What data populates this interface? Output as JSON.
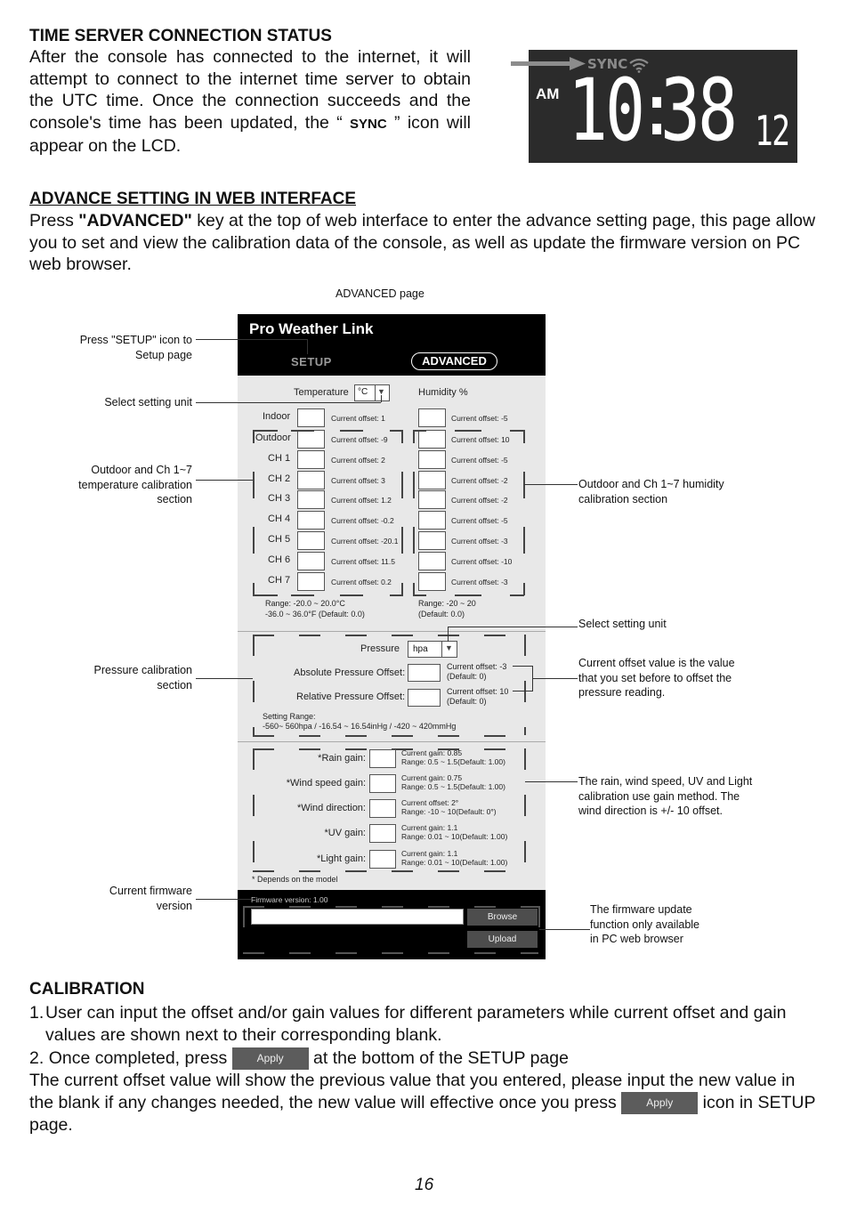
{
  "time_server": {
    "heading": "TIME SERVER CONNECTION STATUS",
    "para_before": "After the console has connected to the internet, it will attempt to connect to the internet time server to obtain the UTC time. Once the connection succeeds and the console's time has been updated, the “",
    "sync_word": "SYNC",
    "para_after": "” icon will appear on the LCD.",
    "lcd": {
      "sync_label": "SYNC",
      "ampm": "AM",
      "hours": "10",
      "minutes": "38",
      "seconds": "12",
      "icons": [
        "arrow-right-icon",
        "wifi-icon"
      ]
    }
  },
  "advance": {
    "heading": "ADVANCE SETTING IN WEB INTERFACE",
    "para_prefix": "Press ",
    "para_key": "\"ADVANCED\"",
    "para_suffix": " key at the top of web interface to enter the advance setting page, this page allow you to set and view the calibration data of the console, as well as update the firmware version on PC web browser.",
    "figure_caption": "ADVANCED page"
  },
  "web_ui": {
    "title": "Pro Weather Link",
    "nav": {
      "setup": "SETUP",
      "advanced": "ADVANCED"
    },
    "temperature_label": "Temperature",
    "temperature_unit": "°C",
    "humidity_label": "Humidity %",
    "temp_rows": [
      {
        "label": "Indoor",
        "current": "Current offset: 1"
      },
      {
        "label": "Outdoor",
        "current": "Current offset: -9"
      },
      {
        "label": "CH 1",
        "current": "Current offset: 2"
      },
      {
        "label": "CH 2",
        "current": "Current offset: 3"
      },
      {
        "label": "CH 3",
        "current": "Current offset: 1.2"
      },
      {
        "label": "CH 4",
        "current": "Current offset: -0.2"
      },
      {
        "label": "CH 5",
        "current": "Current offset: -20.1"
      },
      {
        "label": "CH 6",
        "current": "Current offset: 11.5"
      },
      {
        "label": "CH 7",
        "current": "Current offset: 0.2"
      }
    ],
    "hum_rows": [
      {
        "current": "Current offset: -5"
      },
      {
        "current": "Current offset: 10"
      },
      {
        "current": "Current offset: -5"
      },
      {
        "current": "Current offset: -2"
      },
      {
        "current": "Current offset: -2"
      },
      {
        "current": "Current offset: -5"
      },
      {
        "current": "Current offset: -3"
      },
      {
        "current": "Current offset: -10"
      },
      {
        "current": "Current offset: -3"
      }
    ],
    "temp_range_1": "Range: -20.0 ~ 20.0°C",
    "temp_range_2": "-36.0 ~ 36.0°F (Default: 0.0)",
    "hum_range_1": "Range: -20 ~ 20",
    "hum_range_2": "(Default: 0.0)",
    "pressure": {
      "label": "Pressure",
      "unit": "hpa",
      "abs_label": "Absolute Pressure Offset:",
      "abs_current": "Current offset: -3",
      "abs_default": "(Default: 0)",
      "rel_label": "Relative Pressure Offset:",
      "rel_current": "Current offset: 10",
      "rel_default": "(Default: 0)",
      "range_label": "Setting Range:",
      "range_value": "-560~ 560hpa / -16.54 ~ 16.54inHg / -420 ~ 420mmHg"
    },
    "gains": [
      {
        "label": "*Rain gain:",
        "current": "Current gain: 0.85",
        "range": "Range: 0.5 ~ 1.5(Default: 1.00)"
      },
      {
        "label": "*Wind speed gain:",
        "current": "Current gain: 0.75",
        "range": "Range: 0.5 ~ 1.5(Default: 1.00)"
      },
      {
        "label": "*Wind direction:",
        "current": "Current offset: 2°",
        "range": "Range: -10 ~ 10(Default: 0°)"
      },
      {
        "label": "*UV gain:",
        "current": "Current gain: 1.1",
        "range": "Range: 0.01 ~ 10(Default: 1.00)"
      },
      {
        "label": "*Light gain:",
        "current": "Current gain: 1.1",
        "range": "Range: 0.01 ~ 10(Default: 1.00)"
      }
    ],
    "footnote": "* Depends on the model",
    "firmware": {
      "version": "Firmware version: 1.00",
      "file_value": "",
      "browse": "Browse",
      "upload": "Upload"
    }
  },
  "annotations": {
    "setup_icon": "Press \"SETUP\" icon to\nSetup page",
    "select_unit_left": "Select setting unit",
    "temp_section": "Outdoor and Ch 1~7\ntemperature calibration\nsection",
    "pressure_section": "Pressure calibration\nsection",
    "firmware_version": "Current firmware\nversion",
    "humidity_section": "Outdoor and Ch 1~7 humidity\ncalibration section",
    "select_unit_right": "Select setting unit",
    "current_offset": "Current offset value is the value\nthat you set before to offset the\npressure reading.",
    "gain_method": "The rain, wind speed, UV and Light\ncalibration use gain method. The\nwind direction is +/- 10 offset.",
    "firmware_update": "The firmware update\nfunction only available\nin PC web browser"
  },
  "calibration": {
    "heading": "CALIBRATION",
    "item1_num": "1.",
    "item1": "User can input the offset and/or gain values for different parameters while current offset and gain values are shown next to their corresponding blank.",
    "item2_num": "2.",
    "item2_prefix": "Once completed, press",
    "apply_label": "Apply",
    "item2_suffix": "at the bottom of the SETUP page",
    "para_prefix": "The current offset value will show the previous value that you entered, please input the new value in the blank if any changes needed, the new value will effective once you press",
    "para_suffix": "icon in SETUP page."
  },
  "page_number": "16"
}
